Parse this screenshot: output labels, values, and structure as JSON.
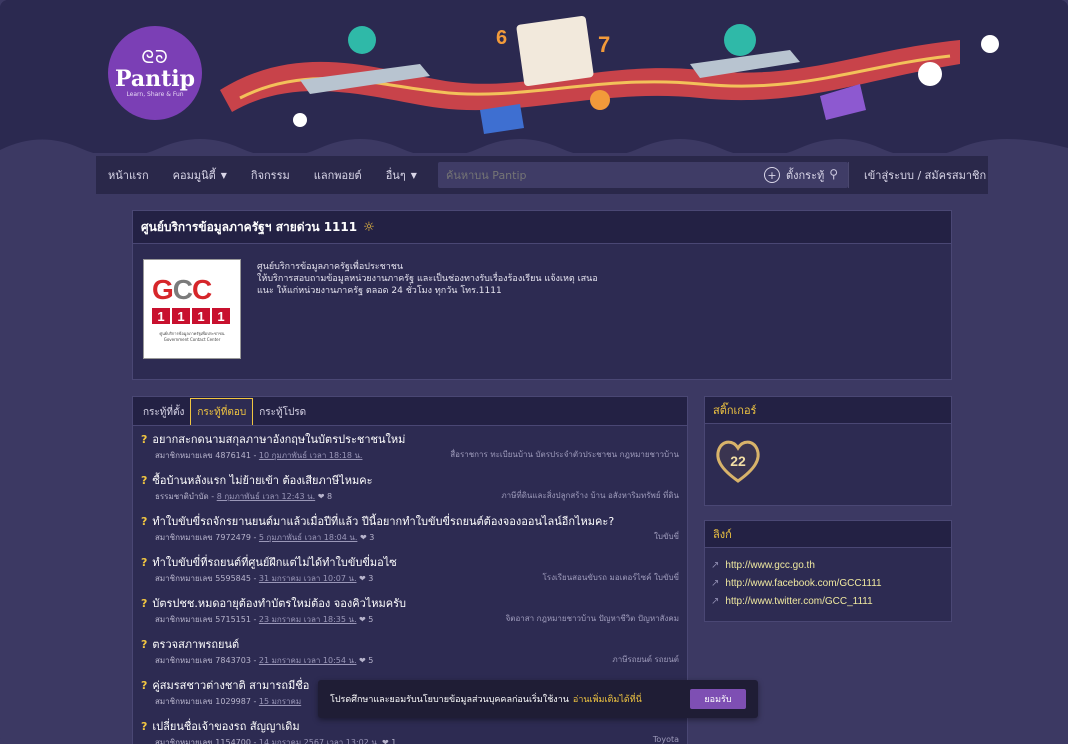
{
  "brand": {
    "mark": "ᘓᘐ",
    "name": "Pantip",
    "tagline": "Learn, Share & Fun"
  },
  "nav": {
    "items": [
      {
        "label": "หน้าแรก",
        "caret": false
      },
      {
        "label": "คอมมูนิตี้",
        "caret": true
      },
      {
        "label": "กิจกรรม",
        "caret": false
      },
      {
        "label": "แลกพอยต์",
        "caret": false
      },
      {
        "label": "อื่นๆ",
        "caret": true
      }
    ],
    "search_placeholder": "ค้นหาบน Pantip",
    "post_label": "ตั้งกระทู้",
    "login_label": "เข้าสู่ระบบ / สมัครสมาชิก"
  },
  "profile": {
    "title": "ศูนย์บริการข้อมูลภาครัฐฯ สายด่วน 1111",
    "logo_letters": [
      "G",
      "C",
      "C"
    ],
    "logo_numbers": [
      "1",
      "1",
      "1",
      "1"
    ],
    "logo_caption": "ศูนย์บริการข้อมูลภาครัฐเพื่อประชาชน Government Contact Center",
    "desc_lines": [
      "ศูนย์บริการข้อมูลภาครัฐเพื่อประชาชน",
      "ให้บริการสอบถามข้อมูลหน่วยงานภาครัฐ และเป็นช่องทางรับเรื่องร้องเรียน แจ้งเหตุ เสนอ",
      "แนะ ให้แก่หน่วยงานภาครัฐ ตลอด 24 ชั่วโมง ทุกวัน โทร.1111"
    ]
  },
  "tabs": [
    {
      "label": "กระทู้ที่ตั้ง",
      "active": false
    },
    {
      "label": "กระทู้ที่ตอบ",
      "active": true
    },
    {
      "label": "กระทู้โปรด",
      "active": false
    }
  ],
  "topics": [
    {
      "title": "อยากสะกดนามสกุลภาษาอังกฤษในบัตรประชาชนใหม่",
      "author": "สมาชิกหมายเลข 4876141",
      "time": "10 กุมภาพันธ์ เวลา 18:18 น.",
      "comments": "",
      "tags": "สื่อราชการ  ทะเบียนบ้าน  บัตรประจำตัวประชาชน  กฎหมายชาวบ้าน"
    },
    {
      "title": "ซื้อบ้านหลังแรก ไม่ย้ายเข้า ต้องเสียภาษีไหมคะ",
      "author": "ธรรมชาติบำบัด",
      "time": "8 กุมภาพันธ์ เวลา 12:43 น.",
      "comments": "8",
      "tags": "ภาษีที่ดินและสิ่งปลูกสร้าง  บ้าน  อสังหาริมทรัพย์  ที่ดิน"
    },
    {
      "title": "ทำใบขับขี่รถจักรยานยนต์มาแล้วเมื่อปีที่แล้ว ปีนี้อยากทำใบขับขี่รถยนต์ต้องจองออนไลน์อีกไหมคะ?",
      "author": "สมาชิกหมายเลข 7972479",
      "time": "5 กุมภาพันธ์ เวลา 18:04 น.",
      "comments": "3",
      "tags": "ใบขับขี่"
    },
    {
      "title": "ทำใบขับขี่ที่รถยนต์ที่ศูนย์ฝึกแต่ไม่ได้ทำใบขับขี่มอไซ",
      "author": "สมาชิกหมายเลข 5595845",
      "time": "31 มกราคม เวลา 10:07 น.",
      "comments": "3",
      "tags": "โรงเรียนสอนขับรถ  มอเตอร์ไซค์  ใบขับขี่"
    },
    {
      "title": "บัตรปชช.หมดอายุต้องทำบัตรใหม่ต้อง จองคิวไหมครับ",
      "author": "สมาชิกหมายเลข 5715151",
      "time": "23 มกราคม เวลา 18:35 น.",
      "comments": "5",
      "tags": "จิตอาสา  กฎหมายชาวบ้าน  ปัญหาชีวิต  ปัญหาสังคม"
    },
    {
      "title": "ตรวจสภาพรถยนต์",
      "author": "สมาชิกหมายเลข 7843703",
      "time": "21 มกราคม เวลา 10:54 น.",
      "comments": "5",
      "tags": "ภาษีรถยนต์  รถยนต์"
    },
    {
      "title": "คู่สมรสชาวต่างชาติ สามารถมีชื่อ",
      "author": "สมาชิกหมายเลข 1029987",
      "time": "15 มกราคม",
      "comments": "",
      "tags": ""
    },
    {
      "title": "เปลี่ยนชื่อเจ้าของรถ สัญญาเดิม",
      "author": "สมาชิกหมายเลข 1154700",
      "time": "14 มกราคม 2567 เวลา 13:02 น.",
      "comments": "1",
      "tags": "Toyota"
    }
  ],
  "sticker_panel": {
    "title": "สติ๊กเกอร์",
    "badge": "22"
  },
  "links_panel": {
    "title": "ลิงก์",
    "links": [
      "http://www.gcc.go.th",
      "http://www.facebook.com/GCC1111",
      "http://www.twitter.com/GCC_1111"
    ]
  },
  "cookie": {
    "text": "โปรดศึกษาและยอมรับนโยบายข้อมูลส่วนบุคคลก่อนเริ่มใช้งาน",
    "more": "อ่านเพิ่มเติมได้ที่นี่",
    "accept": "ยอมรับ"
  }
}
